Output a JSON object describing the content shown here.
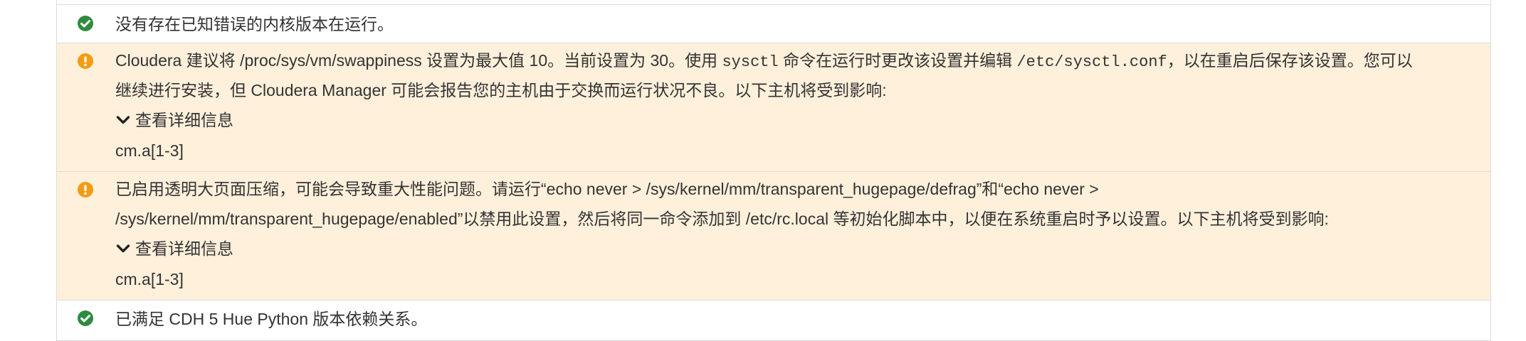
{
  "rows": [
    {
      "status": "ok",
      "text": "没有存在已知错误的内核版本在运行。"
    },
    {
      "status": "warning",
      "line1_a": "Cloudera 建议将 /proc/sys/vm/swappiness 设置为最大值 10。当前设置为 30。使用 ",
      "line1_code1": "sysctl",
      "line1_b": " 命令在运行时更改该设置并编辑 ",
      "line1_code2": "/etc/sysctl.conf",
      "line1_c": "，以在重启后保存该设置。您可以",
      "line2": "继续进行安装，但 Cloudera Manager 可能会报告您的主机由于交换而运行状况不良。以下主机将受到影响:",
      "details_label": "查看详细信息",
      "hosts": "cm.a[1-3]"
    },
    {
      "status": "warning",
      "line1": "已启用透明大页面压缩，可能会导致重大性能问题。请运行“echo never > /sys/kernel/mm/transparent_hugepage/defrag”和“echo never >",
      "line2": "/sys/kernel/mm/transparent_hugepage/enabled”以禁用此设置，然后将同一命令添加到 /etc/rc.local 等初始化脚本中，以便在系统重启时予以设置。以下主机将受到影响:",
      "details_label": "查看详细信息",
      "hosts": "cm.a[1-3]"
    },
    {
      "status": "ok",
      "text": "已满足 CDH 5 Hue Python 版本依赖关系。"
    }
  ],
  "colors": {
    "ok_icon": "#2e8b3e",
    "warning_icon": "#f39c12",
    "warning_bg": "#fef0db",
    "border": "#dddddd",
    "text": "#333333"
  },
  "icons": {
    "ok": "check-circle-icon",
    "warning": "exclamation-circle-icon",
    "expand": "chevron-down-icon"
  }
}
